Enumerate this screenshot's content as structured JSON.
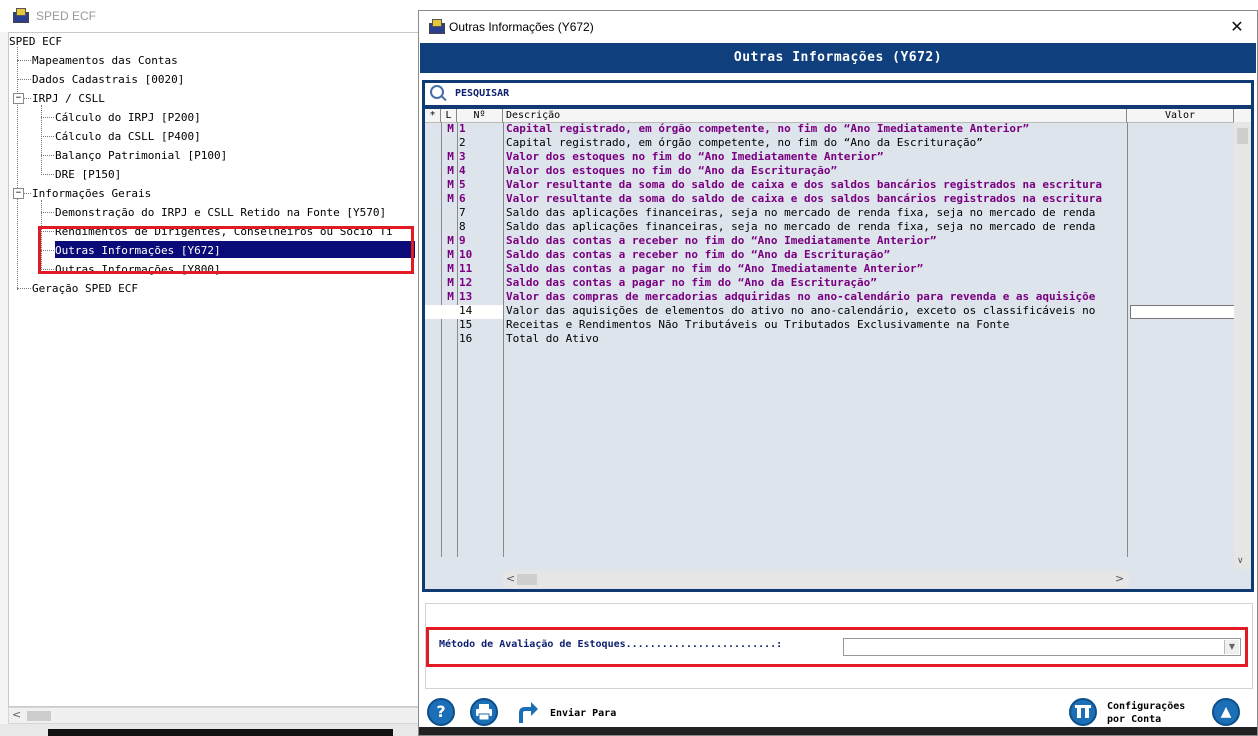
{
  "back_window": {
    "title": "SPED ECF",
    "tree": [
      {
        "label": "SPED ECF"
      },
      {
        "label": "Mapeamentos das Contas"
      },
      {
        "label": "Dados Cadastrais [0020]"
      },
      {
        "label": "IRPJ / CSLL"
      },
      {
        "label": "Cálculo do IRPJ [P200]"
      },
      {
        "label": "Cálculo da CSLL [P400]"
      },
      {
        "label": "Balanço Patrimonial [P100]"
      },
      {
        "label": "DRE [P150]"
      },
      {
        "label": "Informações Gerais"
      },
      {
        "label": "Demonstração do IRPJ e CSLL Retido na Fonte [Y570]"
      },
      {
        "label": "Rendimentos de Dirigentes, Conselheiros ou Sócio Ti"
      },
      {
        "label": "Outras Informações [Y672]"
      },
      {
        "label": "Outras Informações [Y800]"
      },
      {
        "label": "Geração SPED ECF"
      }
    ]
  },
  "dialog": {
    "title": "Outras Informações (Y672)",
    "close_glyph": "✕",
    "header": "Outras Informações (Y672)",
    "search_label": "PESQUISAR",
    "columns": {
      "star": "*",
      "l": "L",
      "n": "Nº",
      "descricao": "Descrição",
      "valor": "Valor"
    },
    "rows": [
      {
        "l": "M",
        "n": "1",
        "desc": "Capital registrado, em órgão competente, no fim do “Ano Imediatamente Anterior”"
      },
      {
        "l": "",
        "n": "2",
        "desc": "Capital registrado, em órgão competente, no fim do “Ano da Escrituração”"
      },
      {
        "l": "M",
        "n": "3",
        "desc": "Valor dos estoques no fim do “Ano Imediatamente Anterior”"
      },
      {
        "l": "M",
        "n": "4",
        "desc": "Valor dos estoques no fim do “Ano da Escrituração”"
      },
      {
        "l": "M",
        "n": "5",
        "desc": "Valor resultante da soma do saldo de caixa e dos saldos bancários registrados na escritura"
      },
      {
        "l": "M",
        "n": "6",
        "desc": "Valor resultante da soma do saldo de caixa e dos saldos bancários registrados na escritura"
      },
      {
        "l": "",
        "n": "7",
        "desc": "Saldo das aplicações financeiras, seja no mercado de renda fixa, seja no mercado de renda"
      },
      {
        "l": "",
        "n": "8",
        "desc": "Saldo das aplicações financeiras, seja no mercado de renda fixa, seja no mercado de renda"
      },
      {
        "l": "M",
        "n": "9",
        "desc": "Saldo das contas a receber no fim do “Ano Imediatamente Anterior”"
      },
      {
        "l": "M",
        "n": "10",
        "desc": "Saldo das contas a receber no fim do “Ano da Escrituração”"
      },
      {
        "l": "M",
        "n": "11",
        "desc": "Saldo das contas a pagar no fim do “Ano Imediatamente Anterior”"
      },
      {
        "l": "M",
        "n": "12",
        "desc": "Saldo das contas a pagar no fim do “Ano da Escrituração”"
      },
      {
        "l": "M",
        "n": "13",
        "desc": "Valor das compras de mercadorias adquiridas no ano-calendário para revenda e as aquisiçõe"
      },
      {
        "l": "",
        "n": "14",
        "desc": "Valor das aquisições de elementos do ativo no ano-calendário, exceto os classificáveis no"
      },
      {
        "l": "",
        "n": "15",
        "desc": "Receitas e Rendimentos Não Tributáveis ou Tributados Exclusivamente na Fonte"
      },
      {
        "l": "",
        "n": "16",
        "desc": "Total do Ativo"
      }
    ],
    "metodo_label": "Método de Avaliação de Estoques.........................:",
    "metodo_value": "",
    "help_glyph": "?",
    "enviar_label": "Enviar Para",
    "config_label_1": "Configurações",
    "config_label_2": "por Conta",
    "up_glyph": "▲"
  }
}
